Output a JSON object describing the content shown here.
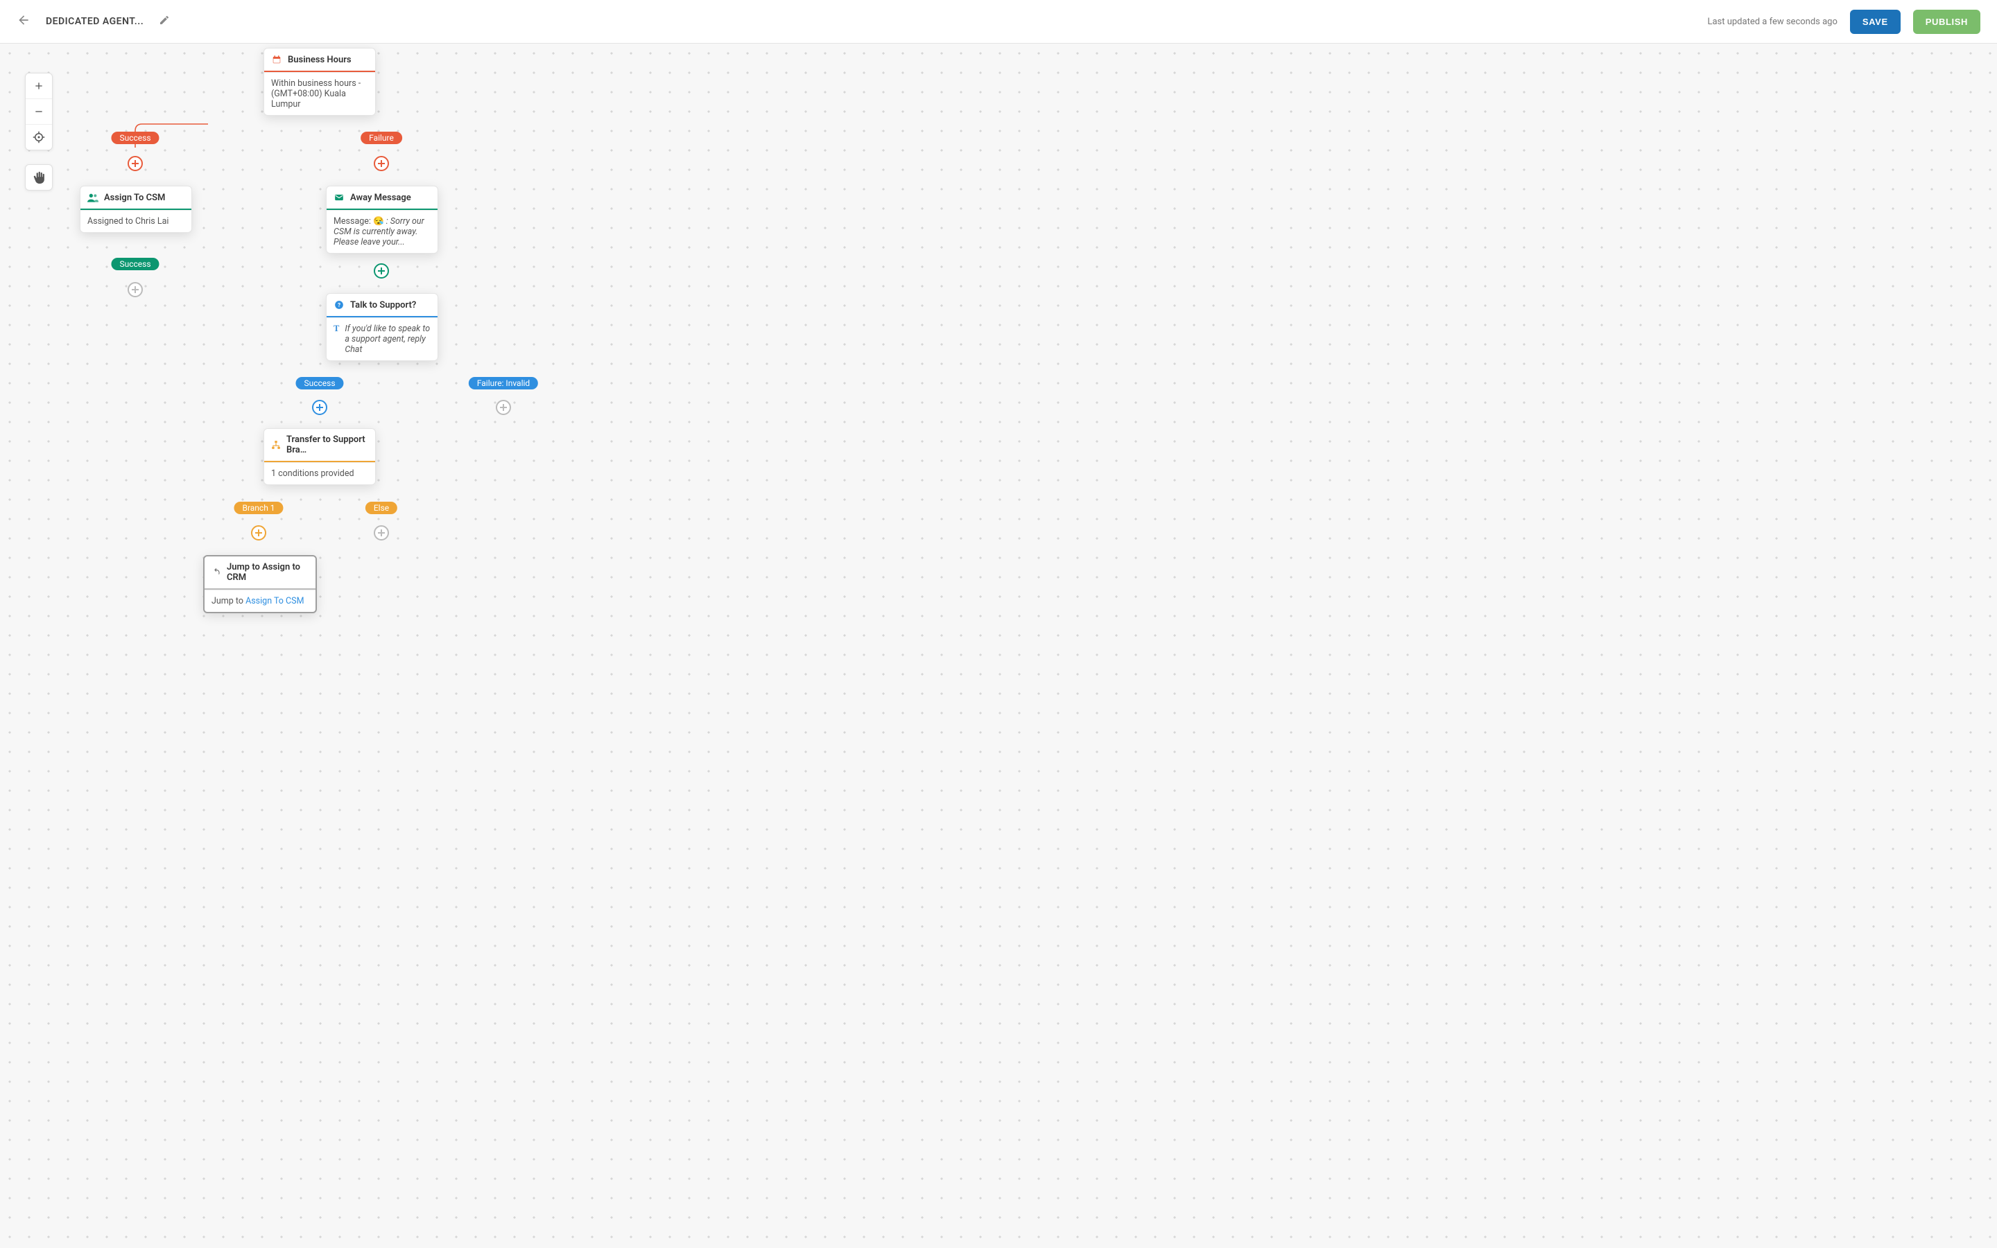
{
  "header": {
    "title": "DEDICATED AGENT...",
    "status_text": "Last updated a few seconds ago",
    "save_label": "SAVE",
    "publish_label": "PUBLISH"
  },
  "palette": {
    "zoom_in": "zoom-in",
    "zoom_out": "zoom-out",
    "center": "recenter",
    "pan_mode": "pan-hand"
  },
  "nodes": {
    "business_hours": {
      "title": "Business Hours",
      "body": "Within business hours - (GMT+08:00) Kuala Lumpur",
      "icon": "calendar-icon"
    },
    "assign_csm": {
      "title": "Assign To CSM",
      "body": "Assigned to Chris Lai",
      "icon": "people-icon"
    },
    "away_message": {
      "title": "Away Message",
      "body_prefix": "Message: 😪 ",
      "body_italic": ": Sorry our CSM is currently away. Please leave your...",
      "icon": "mail-icon"
    },
    "talk_support": {
      "title": "Talk to Support?",
      "body": "If you'd like to speak to a support agent, reply Chat",
      "icon": "question-icon",
      "leading_glyph": "T"
    },
    "transfer": {
      "title": "Transfer to Support Bra…",
      "body": "1 conditions provided",
      "icon": "sitemap-icon"
    },
    "jump": {
      "title": "Jump to Assign to CRM",
      "body_prefix": "Jump to ",
      "link_text": "Assign To CSM",
      "icon": "redo-icon"
    }
  },
  "pills": {
    "bh_success": "Success",
    "bh_failure": "Failure",
    "csm_success": "Success",
    "talk_success": "Success",
    "talk_failure": "Failure: Invalid",
    "branch1": "Branch 1",
    "else": "Else"
  }
}
